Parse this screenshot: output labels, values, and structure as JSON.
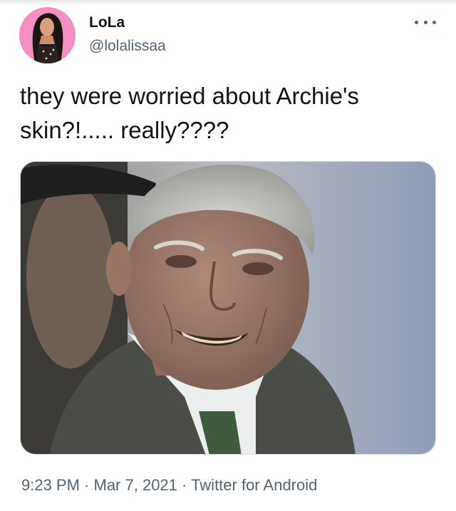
{
  "tweet": {
    "display_name": "LoLa",
    "handle": "@lolalissaa",
    "text": "they were worried about Archie's skin?!..... really????",
    "time": "9:23 PM",
    "separator_1": " · ",
    "date": "Mar 7, 2021",
    "separator_2": " · ",
    "client": "Twitter for Android"
  },
  "icons": {
    "more": "more-horizontal-icon"
  },
  "colors": {
    "text_primary": "#0f1419",
    "text_secondary": "#536471",
    "avatar_bg": "#f48fc2"
  }
}
